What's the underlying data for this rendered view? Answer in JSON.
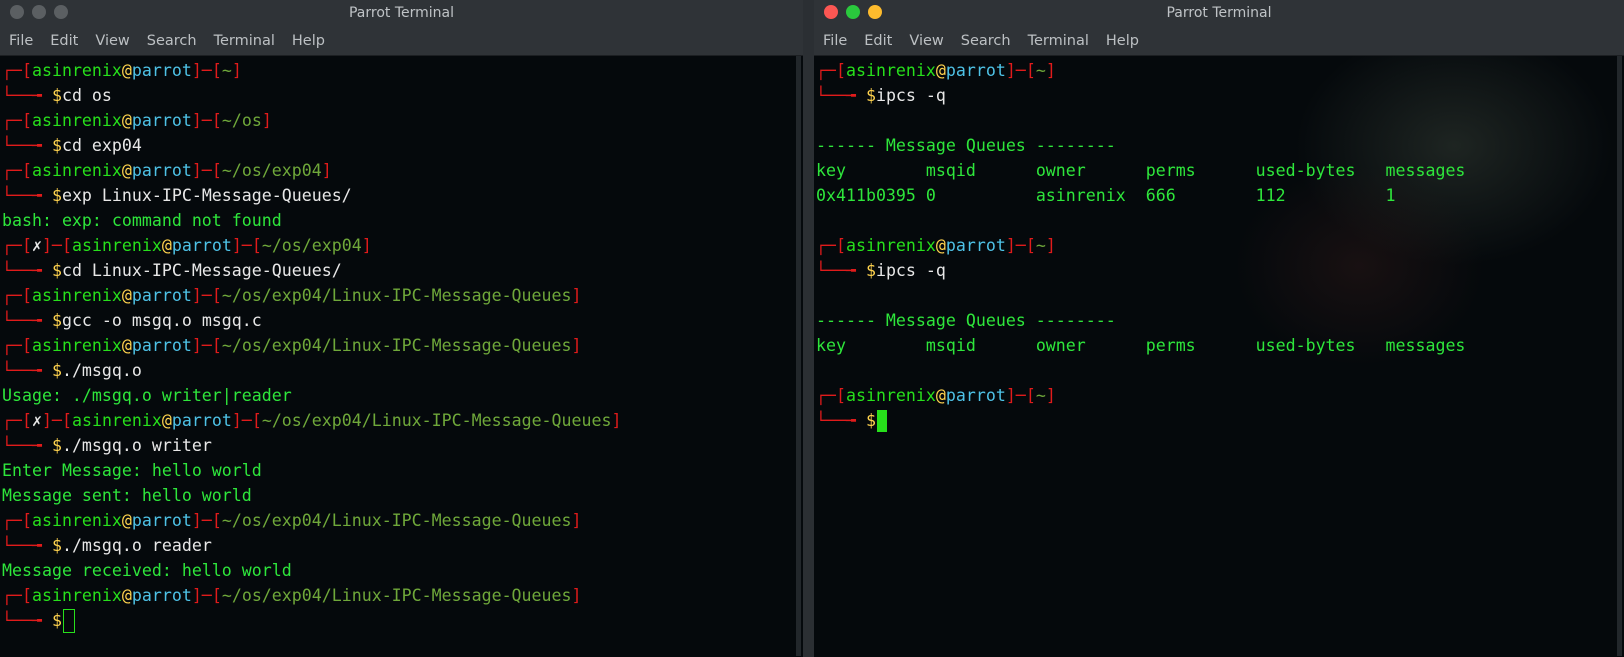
{
  "left": {
    "title": "Parrot Terminal",
    "menu": [
      "File",
      "Edit",
      "View",
      "Search",
      "Terminal",
      "Help"
    ],
    "user": "asinrenix",
    "host": "parrot",
    "lines": [
      {
        "type": "prompt",
        "path": "~"
      },
      {
        "type": "cmd",
        "text": "cd os"
      },
      {
        "type": "prompt",
        "path": "~/os"
      },
      {
        "type": "cmd",
        "text": "cd exp04"
      },
      {
        "type": "prompt",
        "path": "~/os/exp04"
      },
      {
        "type": "cmd",
        "text": "exp Linux-IPC-Message-Queues/"
      },
      {
        "type": "out",
        "text": "bash: exp: command not found"
      },
      {
        "type": "prompt",
        "path": "~/os/exp04",
        "err": "✗"
      },
      {
        "type": "cmd",
        "text": "cd Linux-IPC-Message-Queues/"
      },
      {
        "type": "prompt",
        "path": "~/os/exp04/Linux-IPC-Message-Queues"
      },
      {
        "type": "cmd",
        "text": "gcc -o msgq.o msgq.c"
      },
      {
        "type": "prompt",
        "path": "~/os/exp04/Linux-IPC-Message-Queues"
      },
      {
        "type": "cmd",
        "text": "./msgq.o"
      },
      {
        "type": "out",
        "text": "Usage: ./msgq.o writer|reader"
      },
      {
        "type": "prompt",
        "path": "~/os/exp04/Linux-IPC-Message-Queues",
        "err": "✗"
      },
      {
        "type": "cmd",
        "text": "./msgq.o writer"
      },
      {
        "type": "out",
        "text": "Enter Message: hello world"
      },
      {
        "type": "out",
        "text": "Message sent: hello world"
      },
      {
        "type": "prompt",
        "path": "~/os/exp04/Linux-IPC-Message-Queues"
      },
      {
        "type": "cmd",
        "text": "./msgq.o reader"
      },
      {
        "type": "out",
        "text": "Message received: hello world"
      },
      {
        "type": "prompt",
        "path": "~/os/exp04/Linux-IPC-Message-Queues"
      },
      {
        "type": "cmd",
        "text": "",
        "cursor": "outline"
      }
    ]
  },
  "right": {
    "title": "Parrot Terminal",
    "menu": [
      "File",
      "Edit",
      "View",
      "Search",
      "Terminal",
      "Help"
    ],
    "user": "asinrenix",
    "host": "parrot",
    "lines": [
      {
        "type": "prompt",
        "path": "~"
      },
      {
        "type": "cmd",
        "text": "ipcs -q"
      },
      {
        "type": "blank"
      },
      {
        "type": "out",
        "text": "------ Message Queues --------"
      },
      {
        "type": "table",
        "cells": [
          "key",
          "msqid",
          "owner",
          "perms",
          "used-bytes",
          "messages"
        ]
      },
      {
        "type": "table",
        "cells": [
          "0x411b0395",
          "0",
          "asinrenix",
          "666",
          "112",
          "1"
        ]
      },
      {
        "type": "blank"
      },
      {
        "type": "prompt",
        "path": "~"
      },
      {
        "type": "cmd",
        "text": "ipcs -q"
      },
      {
        "type": "blank"
      },
      {
        "type": "out",
        "text": "------ Message Queues --------"
      },
      {
        "type": "table",
        "cells": [
          "key",
          "msqid",
          "owner",
          "perms",
          "used-bytes",
          "messages"
        ]
      },
      {
        "type": "blank"
      },
      {
        "type": "prompt",
        "path": "~"
      },
      {
        "type": "cmd",
        "text": "",
        "cursor": "block"
      }
    ]
  }
}
